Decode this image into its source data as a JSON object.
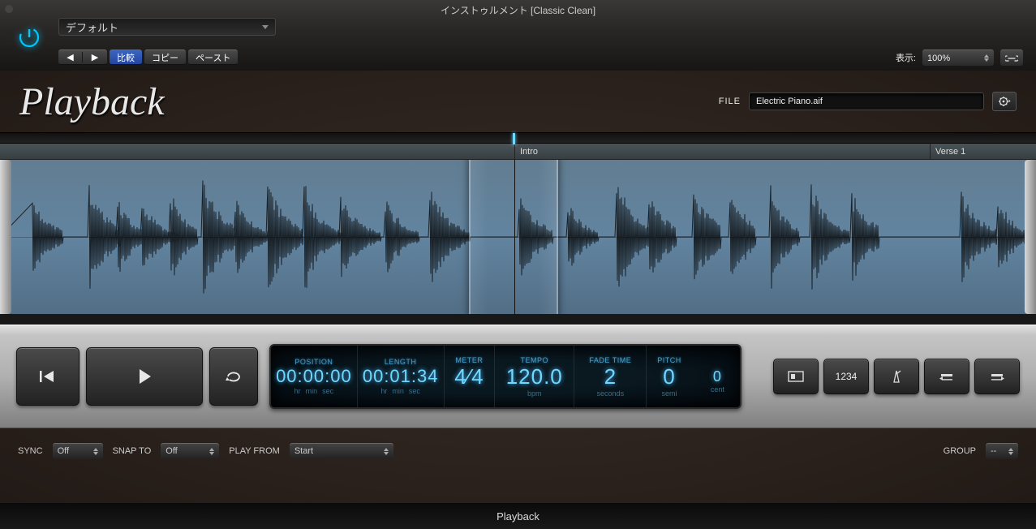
{
  "window": {
    "title": "インストゥルメント [Classic Clean]"
  },
  "header": {
    "preset": "デフォルト",
    "compare_label": "比較",
    "copy_label": "コピー",
    "paste_label": "ペースト",
    "view_label": "表示:",
    "zoom": "100%"
  },
  "plugin": {
    "logo": "Playback",
    "file_label": "FILE",
    "file_value": "Electric Piano.aif"
  },
  "markers": {
    "intro": "Intro",
    "verse1": "Verse 1"
  },
  "lcd": {
    "position": {
      "head": "POSITION",
      "value": "00:00:00",
      "units": [
        "hr",
        "min",
        "sec"
      ]
    },
    "length": {
      "head": "LENGTH",
      "value": "00:01:34",
      "units": [
        "hr",
        "min",
        "sec"
      ]
    },
    "meter": {
      "head": "METER",
      "value": "4⁄4"
    },
    "tempo": {
      "head": "TEMPO",
      "value": "120.0",
      "unit": "bpm"
    },
    "fade": {
      "head": "FADE TIME",
      "value": "2",
      "unit": "seconds"
    },
    "pitch": {
      "head": "PITCH",
      "semi": "0",
      "cent": "0",
      "semi_label": "semi",
      "cent_label": "cent"
    }
  },
  "right_buttons": {
    "count_label": "1234"
  },
  "bottom": {
    "sync_label": "SYNC",
    "sync_value": "Off",
    "snap_label": "SNAP TO",
    "snap_value": "Off",
    "playfrom_label": "PLAY FROM",
    "playfrom_value": "Start",
    "group_label": "GROUP",
    "group_value": "--"
  },
  "footer": {
    "name": "Playback"
  }
}
